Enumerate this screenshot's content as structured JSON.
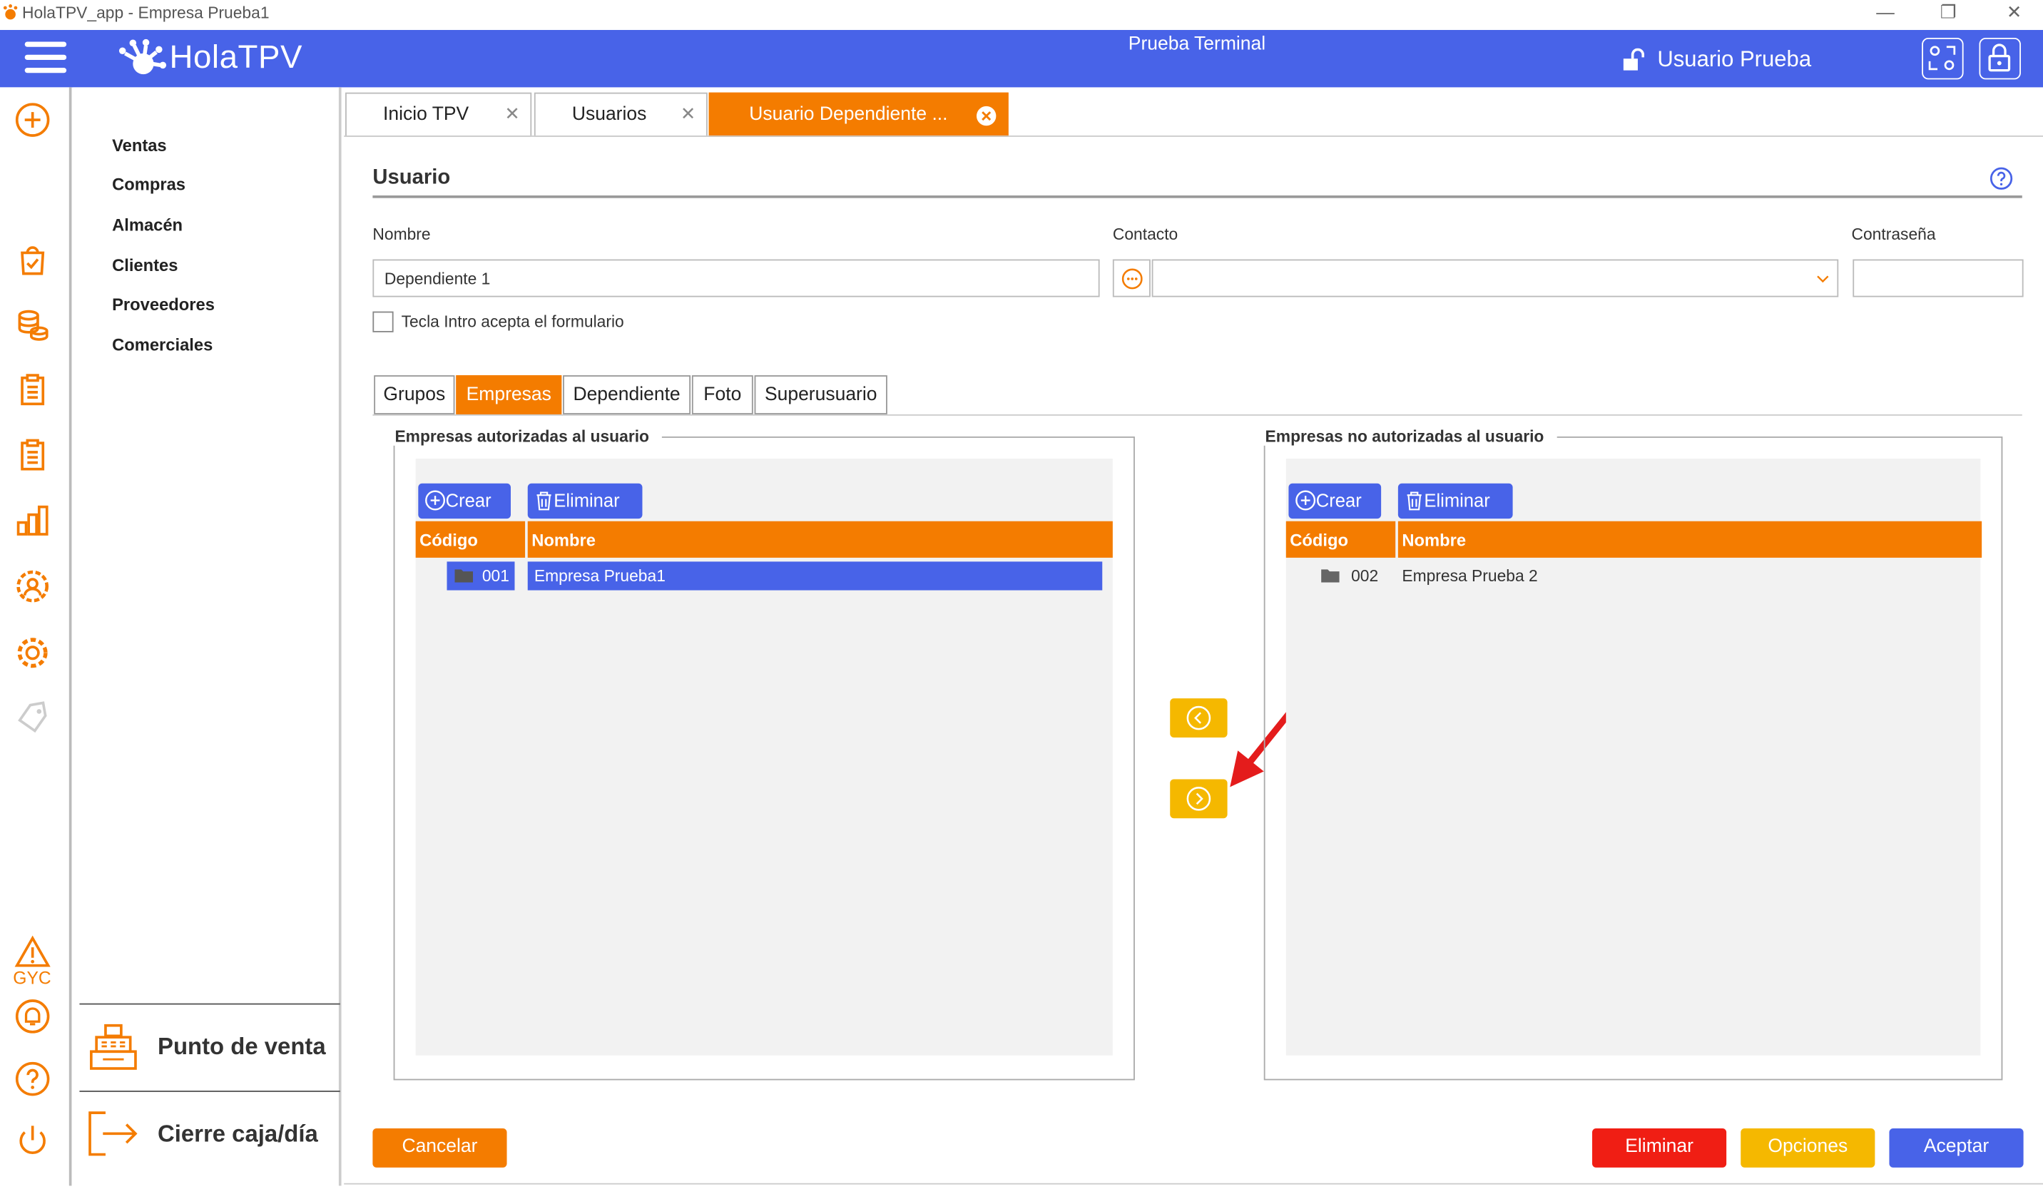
{
  "window": {
    "title": "HolaTPV_app - Empresa Prueba1"
  },
  "header": {
    "logo": "HolaTPV",
    "terminal": "Prueba Terminal",
    "user": "Usuario Prueba"
  },
  "rail": {
    "gyc": "GYC"
  },
  "menu": {
    "items": [
      "Ventas",
      "Compras",
      "Almacén",
      "Clientes",
      "Proveedores",
      "Comerciales"
    ],
    "punto_venta": "Punto de venta",
    "cierre": "Cierre caja/día"
  },
  "tabs": [
    {
      "label": "Inicio TPV"
    },
    {
      "label": "Usuarios"
    },
    {
      "label": "Usuario Dependiente ..."
    }
  ],
  "form": {
    "section_title": "Usuario",
    "nombre_label": "Nombre",
    "nombre_value": "Dependiente 1",
    "contacto_label": "Contacto",
    "contacto_value": "",
    "contrasena_label": "Contraseña",
    "contrasena_value": "",
    "checkbox_label": "Tecla Intro acepta el formulario",
    "checkbox_checked": false
  },
  "subtabs": [
    "Grupos",
    "Empresas",
    "Dependiente",
    "Foto",
    "Superusuario"
  ],
  "active_subtab": "Empresas",
  "authorized": {
    "legend": "Empresas autorizadas al usuario",
    "crear": "Crear",
    "eliminar": "Eliminar",
    "col_codigo": "Código",
    "col_nombre": "Nombre",
    "rows": [
      {
        "codigo": "001",
        "nombre": "Empresa Prueba1",
        "selected": true
      }
    ]
  },
  "unauthorized": {
    "legend": "Empresas no autorizadas al usuario",
    "crear": "Crear",
    "eliminar": "Eliminar",
    "col_codigo": "Código",
    "col_nombre": "Nombre",
    "rows": [
      {
        "codigo": "002",
        "nombre": "Empresa Prueba 2",
        "selected": false
      }
    ]
  },
  "footer": {
    "cancelar": "Cancelar",
    "eliminar": "Eliminar",
    "opciones": "Opciones",
    "aceptar": "Aceptar"
  },
  "colors": {
    "brand_blue": "#4863e8",
    "accent_orange": "#f47c00",
    "arrow_yellow": "#f5b800",
    "danger_red": "#f01e14",
    "annotation_red": "#e41c1c"
  }
}
